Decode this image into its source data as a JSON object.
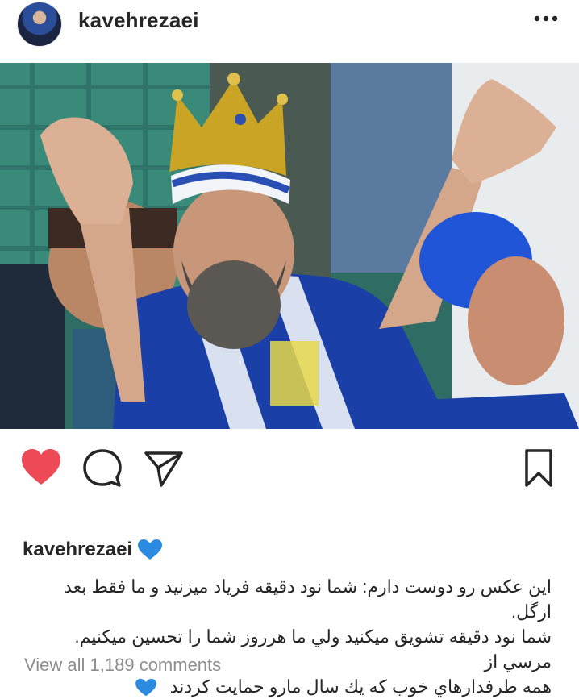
{
  "post": {
    "username": "kavehrezaei",
    "caption_username": "kavehrezaei",
    "caption_lines": [
      "اين عكس رو دوست دارم: شما نود دقيقه فرياد ميزنيد و ما فقط بعد ازگل.",
      "شما نود دقيقه تشويق ميكنيد ولي ما هرروز شما را تحسين ميكنيم. مرسي از",
      "همه طرفدارهاي خوب كه يك سال مارو حمايت كردند"
    ],
    "comments_link": "View all 1,189 comments"
  },
  "icons": {
    "more": "more-horizontal-icon",
    "like": "heart-filled-icon",
    "comment": "comment-bubble-icon",
    "share": "paper-plane-icon",
    "save": "bookmark-icon",
    "emoji": "blue-heart-emoji"
  },
  "colors": {
    "like_red": "#ed4956",
    "emoji_blue": "#2b8be0",
    "muted_text": "#8e8e8e",
    "text": "#262626"
  },
  "state": {
    "liked": true
  }
}
